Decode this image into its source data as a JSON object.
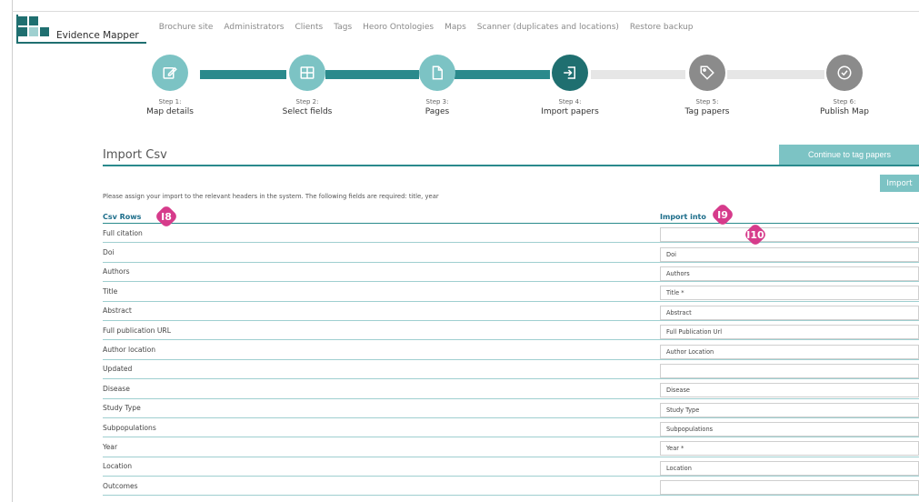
{
  "nav": {
    "logo_text": "Evidence Mapper",
    "links": [
      "Brochure site",
      "Administrators",
      "Clients",
      "Tags",
      "Heoro Ontologies",
      "Maps",
      "Scanner (duplicates and locations)",
      "Restore backup"
    ]
  },
  "colors": {
    "primary": "#2a8a8c",
    "primary_light": "#7cc3c4",
    "active_step": "#1f6f70",
    "inactive_step": "#8b8b8b",
    "marker": "#d63b8b"
  },
  "stepper": {
    "steps": [
      {
        "num": "Step 1:",
        "label": "Map details",
        "icon": "edit-icon",
        "state": "complete"
      },
      {
        "num": "Step 2:",
        "label": "Select fields",
        "icon": "grid-icon",
        "state": "complete"
      },
      {
        "num": "Step 3:",
        "label": "Pages",
        "icon": "page-icon",
        "state": "complete"
      },
      {
        "num": "Step 4:",
        "label": "Import papers",
        "icon": "import-icon",
        "state": "active"
      },
      {
        "num": "Step 5:",
        "label": "Tag papers",
        "icon": "tag-icon",
        "state": "inactive"
      },
      {
        "num": "Step 6:",
        "label": "Publish Map",
        "icon": "check-icon",
        "state": "inactive"
      }
    ]
  },
  "page": {
    "title": "Import Csv",
    "continue_label": "Continue to tag papers",
    "import_label": "Import",
    "instructions": "Please assign your import to the relevant headers in the system. The following fields are required: title, year"
  },
  "table": {
    "col_left": "Csv Rows",
    "col_right": "Import into",
    "rows": [
      {
        "label": "Full citation",
        "value": ""
      },
      {
        "label": "Doi",
        "value": "Doi"
      },
      {
        "label": "Authors",
        "value": "Authors"
      },
      {
        "label": "Title",
        "value": "Title *"
      },
      {
        "label": "Abstract",
        "value": "Abstract"
      },
      {
        "label": "Full publication URL",
        "value": "Full Publication Url"
      },
      {
        "label": "Author location",
        "value": "Author Location"
      },
      {
        "label": "Updated",
        "value": ""
      },
      {
        "label": "Disease",
        "value": "Disease"
      },
      {
        "label": "Study Type",
        "value": "Study Type"
      },
      {
        "label": "Subpopulations",
        "value": "Subpopulations"
      },
      {
        "label": "Year",
        "value": "Year *"
      },
      {
        "label": "Location",
        "value": "Location"
      },
      {
        "label": "Outcomes",
        "value": ""
      }
    ]
  },
  "markers": {
    "m1": "I8",
    "m2": "I9",
    "m3": "I10"
  }
}
